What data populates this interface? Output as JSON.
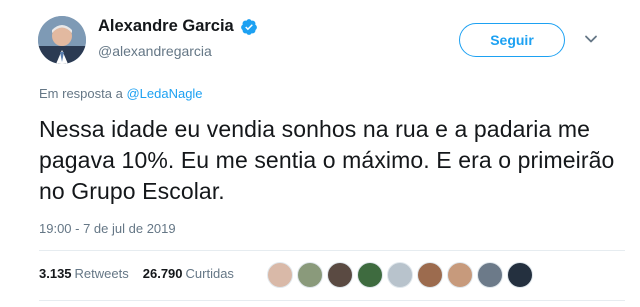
{
  "author": {
    "display_name": "Alexandre Garcia",
    "handle": "@alexandregarcia",
    "verified": true,
    "avatar_icon": "profile-photo"
  },
  "follow_button": {
    "label": "Seguir"
  },
  "reply_context": {
    "prefix": "Em resposta a",
    "mention": "@LedaNagle"
  },
  "tweet": {
    "text": "Nessa idade eu vendia sonhos na rua e a padaria me pagava 10%. Eu me sentia o máximo. E era o primeirão no Grupo Escolar.",
    "timestamp": "19:00 - 7 de jul de 2019"
  },
  "stats": {
    "retweets_count": "3.135",
    "retweets_label": "Retweets",
    "likes_count": "26.790",
    "likes_label": "Curtidas"
  },
  "liker_avatars": [
    {
      "color": "#d9b9a8"
    },
    {
      "color": "#8a9a7b"
    },
    {
      "color": "#5a4a42"
    },
    {
      "color": "#3e6b3f"
    },
    {
      "color": "#b8c3cc"
    },
    {
      "color": "#9c6b4e"
    },
    {
      "color": "#c79a7c"
    },
    {
      "color": "#6c7a89"
    },
    {
      "color": "#24303f"
    }
  ],
  "colors": {
    "accent": "#1da1f2",
    "text": "#14171a",
    "muted": "#657786"
  }
}
